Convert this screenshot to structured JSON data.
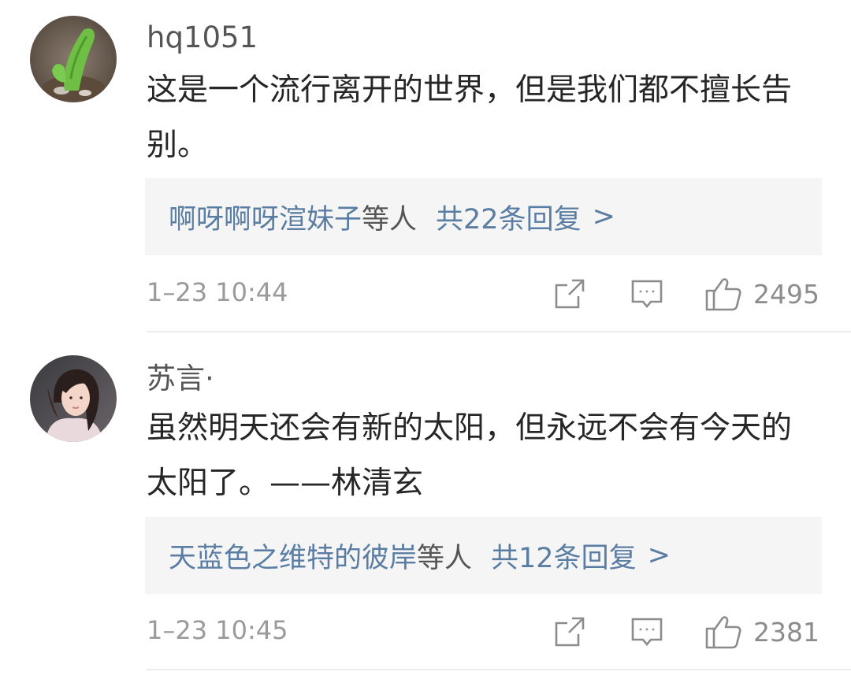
{
  "comments": [
    {
      "username": "hq1051",
      "text": "这是一个流行离开的世界，但是我们都不擅长告别。",
      "replies": {
        "names": "啊呀啊呀渲妹子",
        "suffix": "等人",
        "count": "共22条回复",
        "chevron": ">"
      },
      "timestamp": "1–23 10:44",
      "likes": "2495",
      "avatar_icon": "cactus-photo-avatar"
    },
    {
      "username": "苏言·",
      "text": "虽然明天还会有新的太阳，但永远不会有今天的太阳了。——林清玄",
      "replies": {
        "names": "天蓝色之维特的彼岸",
        "suffix": "等人",
        "count": "共12条回复",
        "chevron": ">"
      },
      "timestamp": "1–23 10:45",
      "likes": "2381",
      "avatar_icon": "woman-portrait-avatar"
    }
  ],
  "icons": {
    "share": "share-icon",
    "comment": "comment-icon",
    "like": "thumbs-up-icon"
  },
  "colors": {
    "reply_link": "#5a7ea3",
    "reply_bg": "#f5f5f5",
    "meta_gray": "#9a9a9a"
  }
}
